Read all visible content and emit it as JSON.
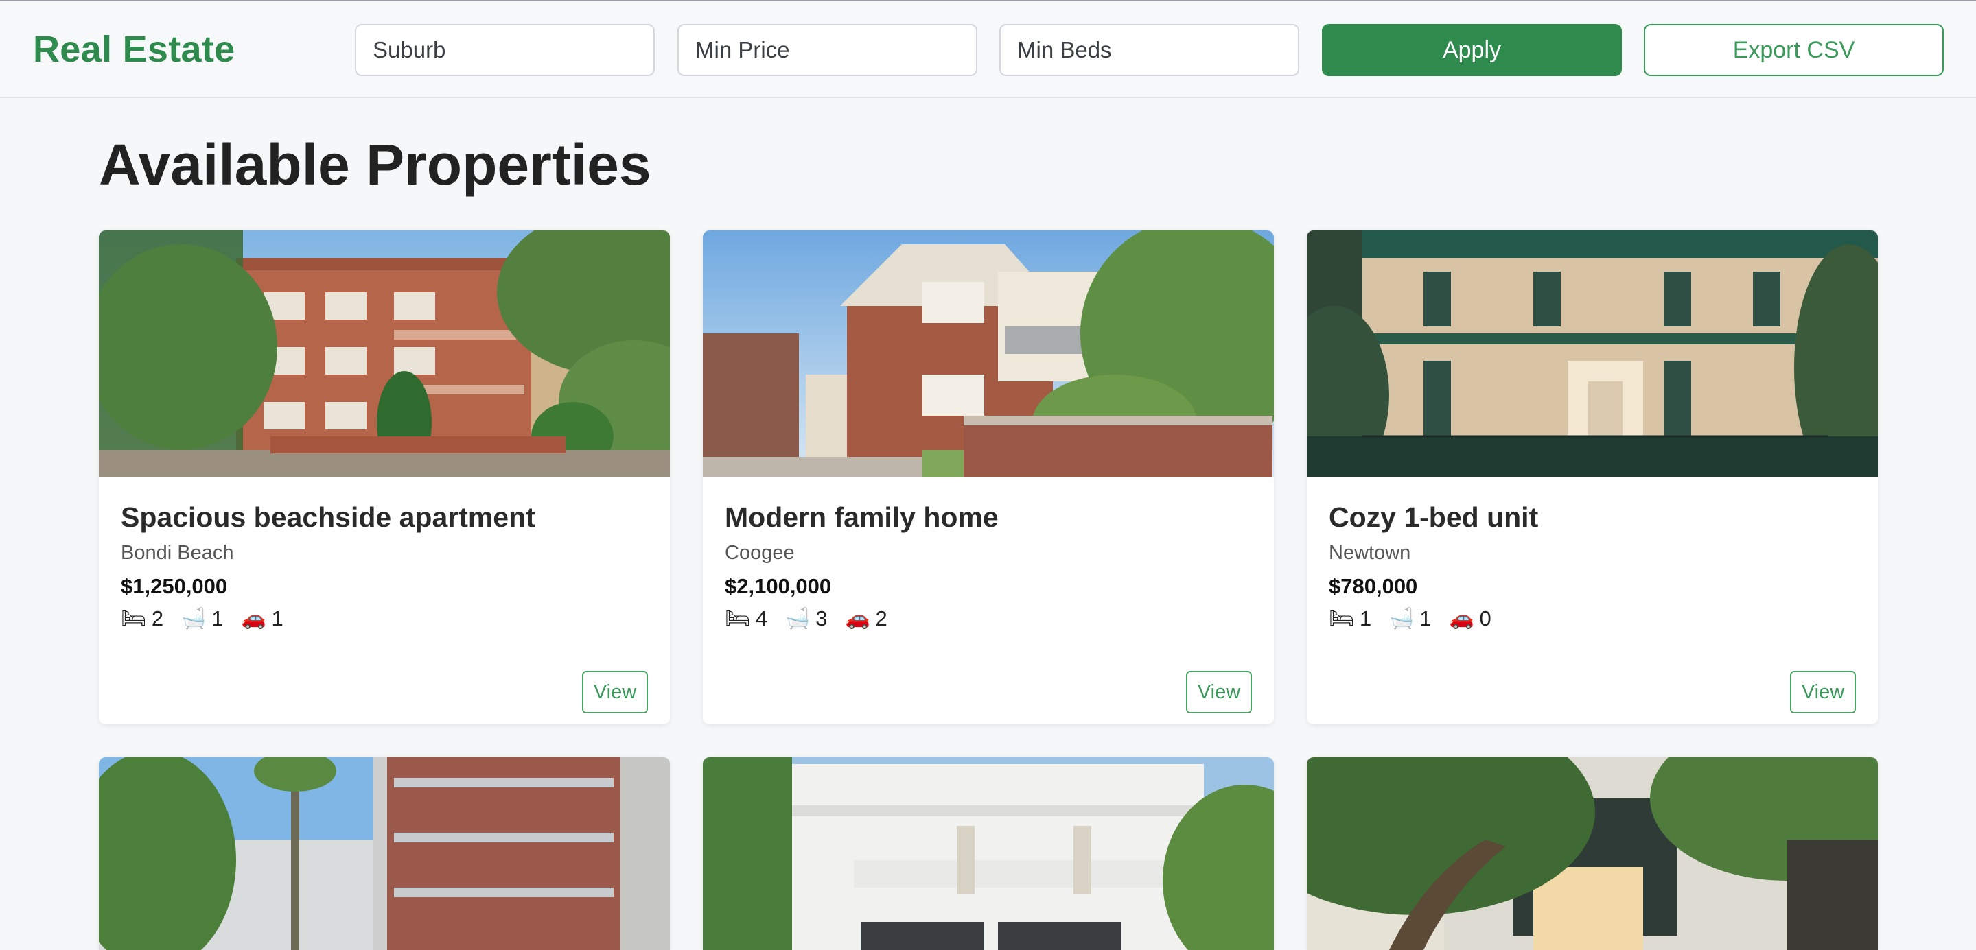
{
  "header": {
    "brand": "Real Estate",
    "filters": {
      "suburb_placeholder": "Suburb",
      "min_price_placeholder": "Min Price",
      "min_beds_placeholder": "Min Beds"
    },
    "apply_label": "Apply",
    "export_label": "Export CSV"
  },
  "main": {
    "title": "Available Properties",
    "view_label": "View",
    "listings": [
      {
        "title": "Spacious beachside apartment",
        "suburb": "Bondi Beach",
        "price": "$1,250,000",
        "beds": "2",
        "baths": "1",
        "cars": "1"
      },
      {
        "title": "Modern family home",
        "suburb": "Coogee",
        "price": "$2,100,000",
        "beds": "4",
        "baths": "3",
        "cars": "2"
      },
      {
        "title": "Cozy 1-bed unit",
        "suburb": "Newtown",
        "price": "$780,000",
        "beds": "1",
        "baths": "1",
        "cars": "0"
      }
    ],
    "icons": {
      "bed": "🛏",
      "bath": "🛁",
      "car": "🚗"
    }
  },
  "colors": {
    "accent": "#2f8a4e",
    "background": "#f5f7f9"
  }
}
